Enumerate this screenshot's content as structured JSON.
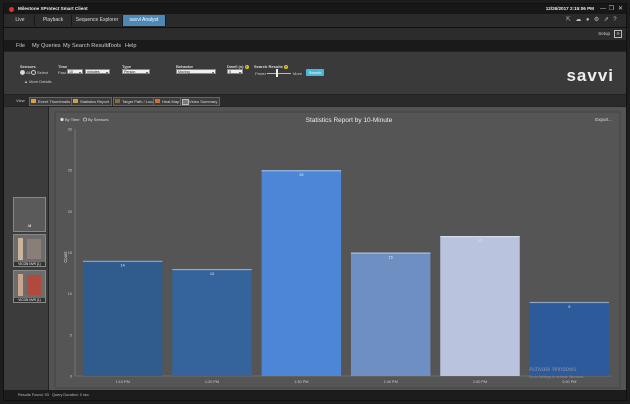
{
  "window": {
    "title": "Milestone XProtect Smart Client",
    "datetime": "12/26/2017 2:15:06 PM"
  },
  "tabs": [
    {
      "label": "Live"
    },
    {
      "label": "Playback"
    },
    {
      "label": "Sequence Explorer"
    },
    {
      "label": "savvi Analyst"
    }
  ],
  "setup": {
    "label": "Setup"
  },
  "menu": [
    "File",
    "My Queries",
    "My Search Results",
    "Tools",
    "Help"
  ],
  "filters": {
    "sensors_label": "Sensors",
    "sensors_options": [
      "All",
      "Select"
    ],
    "more_details": "More Details",
    "time_label": "Time",
    "time_prefix": "Past",
    "time_value": "10",
    "time_unit": "minutes",
    "type_label": "Type",
    "type_value": "Person",
    "behavior_label": "Behavior",
    "behavior_value": "Moving",
    "dwell_label": "Dwell (s)",
    "dwell_value": "0",
    "search_results_label": "Search Results",
    "fewer_label": "Fewer",
    "more_label": "More",
    "search_button": "Search",
    "brand": "savvi"
  },
  "view": {
    "label": "View",
    "buttons": [
      "Event Thumbnails",
      "Statistics Report",
      "Target Path / Location",
      "Heat Map",
      "Video Summary"
    ]
  },
  "sensors": {
    "all_label": "All",
    "items": [
      {
        "label": "VICON NVR (1)"
      },
      {
        "label": "VICON NVR (1)"
      }
    ]
  },
  "chart_data": {
    "type": "bar",
    "title": "Statistics Report by 10-Minute",
    "mode_options": [
      "By Time",
      "By Sensors"
    ],
    "export_label": "Export...",
    "ylabel": "Count",
    "ylim": [
      0,
      30
    ],
    "yticks": [
      0,
      5,
      10,
      15,
      20,
      25,
      30
    ],
    "categories": [
      "1:10 PM",
      "1:20 PM",
      "1:30 PM",
      "1:40 PM",
      "1:50 PM",
      "2:00 PM"
    ],
    "values": [
      14,
      13,
      25,
      15,
      17,
      9
    ],
    "bar_colors": [
      "#2f5b8d",
      "#34649b",
      "#4d86d6",
      "#6e8fc2",
      "#b9c3de",
      "#2d5a9a"
    ],
    "grid": false
  },
  "watermark": {
    "line1": "Activate Windows",
    "line2": "Go to Settings to activate Windows."
  },
  "status": {
    "results_found": "Results Found: 93",
    "query_duration": "Query Duration: 0 sec"
  }
}
